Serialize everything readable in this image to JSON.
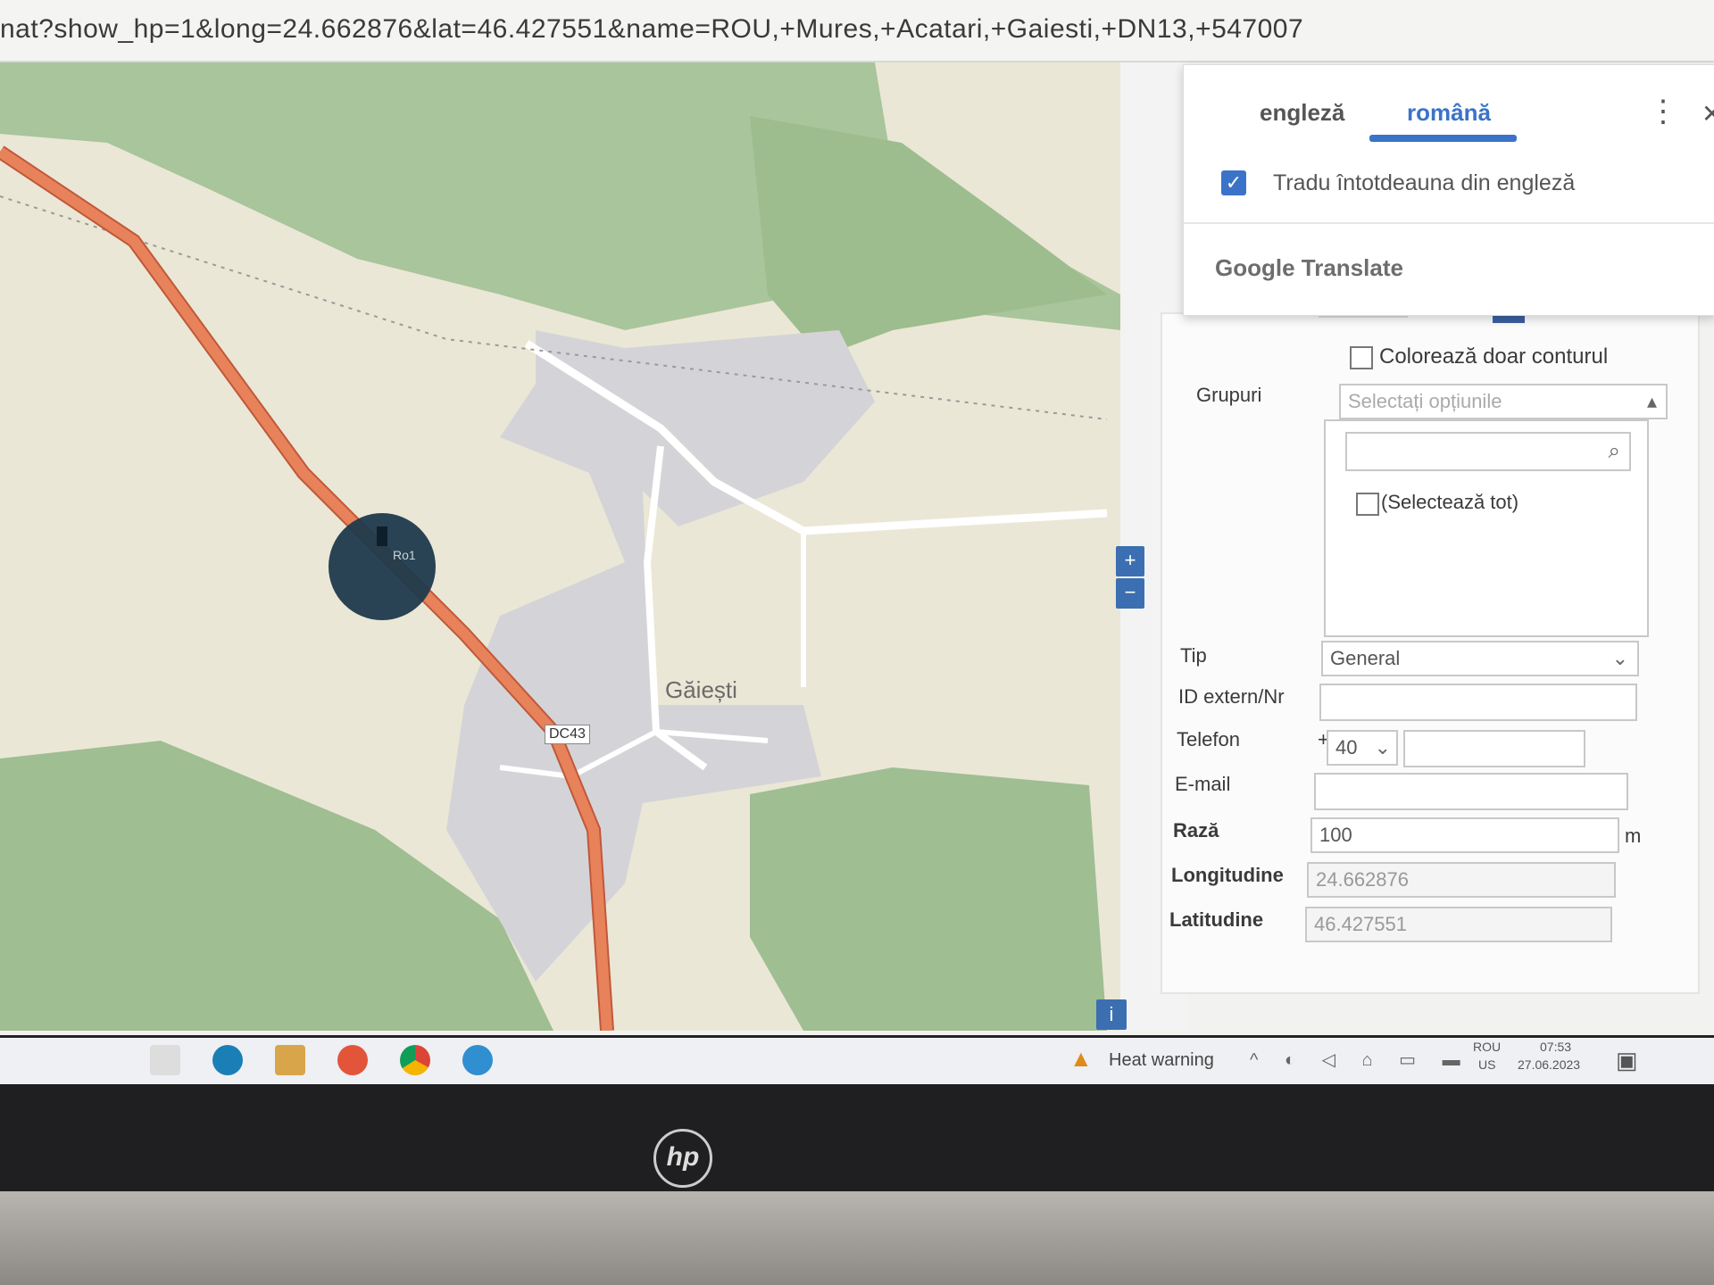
{
  "browser": {
    "url": "nat?show_hp=1&long=24.662876&lat=46.427551&name=ROU,+Mures,+Acatari,+Gaiesti,+DN13,+547007"
  },
  "map": {
    "place_label": "Găiești",
    "road_label": "DC43",
    "marker_label": "Ro1",
    "zoom_in": "+",
    "zoom_out": "−",
    "info_button": "i"
  },
  "translate": {
    "tab_en": "engleză",
    "tab_ro": "română",
    "always_translate": "Tradu întotdeauna din engleză",
    "provider": "Google Translate"
  },
  "form": {
    "outline_only": "Colorează doar conturul",
    "groups_label": "Grupuri",
    "groups_placeholder": "Selectați opțiunile",
    "select_all": "(Selectează tot)",
    "type_label": "Tip",
    "type_value": "General",
    "external_id_label": "ID extern/Nr",
    "phone_label": "Telefon",
    "phone_prefix": "40",
    "email_label": "E-mail",
    "radius_label": "Rază",
    "radius_value": "100",
    "radius_unit": "m",
    "longitude_label": "Longitudine",
    "longitude_value": "24.662876",
    "latitude_label": "Latitudine",
    "latitude_value": "46.427551"
  },
  "taskbar": {
    "weather": "Heat warning",
    "lang": "ROU",
    "lang2": "US",
    "time": "07:53",
    "date": "27.06.2023"
  },
  "colors": {
    "accent": "#3b73c9",
    "road": "#e8825a",
    "forest": "#a9c59b",
    "residential": "#d5d5d9",
    "marker": "#1f3a4d"
  }
}
